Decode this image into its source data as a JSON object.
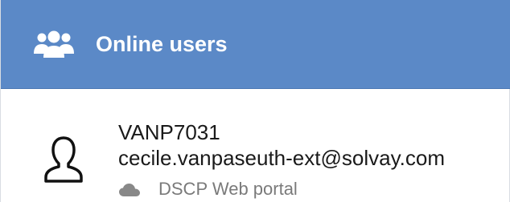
{
  "header": {
    "icon": "users-icon",
    "title": "Online users"
  },
  "user": {
    "avatar_icon": "user-outline-icon",
    "id": "VANP7031",
    "email": "cecile.vanpaseuth-ext@solvay.com",
    "portal_icon": "cloud-icon",
    "portal": "DSCP Web portal"
  },
  "colors": {
    "header_bg": "#5b89c7",
    "header_text": "#ffffff",
    "body_text": "#1a1a1a",
    "muted_text": "#7a7a7a"
  }
}
